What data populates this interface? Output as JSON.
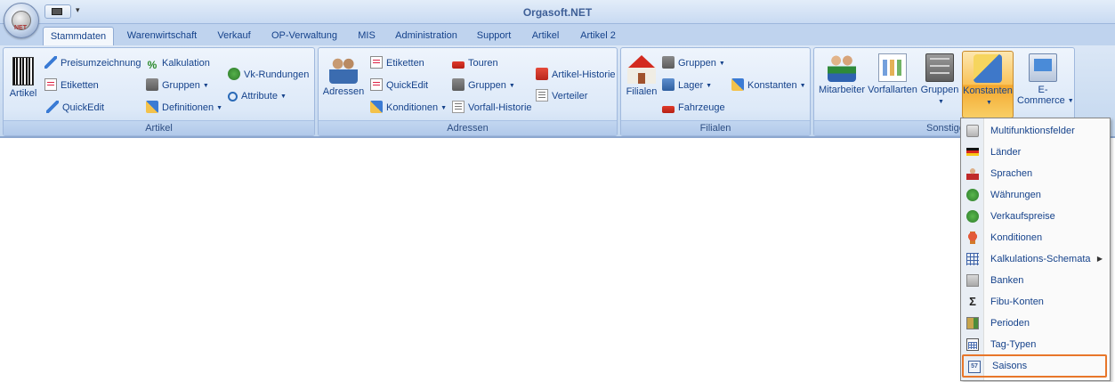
{
  "app": {
    "title": "Orgasoft.NET",
    "orb_text": "NET"
  },
  "tabs": [
    "Stammdaten",
    "Warenwirtschaft",
    "Verkauf",
    "OP-Verwaltung",
    "MIS",
    "Administration",
    "Support",
    "Artikel",
    "Artikel 2"
  ],
  "groups": {
    "artikel": {
      "label": "Artikel",
      "big_button": "Artikel",
      "items": [
        "Preisumzeichnung",
        "Etiketten",
        "QuickEdit",
        "Kalkulation",
        "Gruppen",
        "Definitionen",
        "Vk-Rundungen",
        "Attribute"
      ]
    },
    "adressen": {
      "label": "Adressen",
      "big_button": "Adressen",
      "items": [
        "Etiketten",
        "QuickEdit",
        "Konditionen",
        "Touren",
        "Gruppen",
        "Vorfall-Historie",
        "Artikel-Historie",
        "Verteiler"
      ]
    },
    "filialen": {
      "label": "Filialen",
      "big_button": "Filialen",
      "items": [
        "Gruppen",
        "Lager",
        "Fahrzeuge",
        "Konstanten"
      ]
    },
    "sonstige": {
      "label": "Sonstige",
      "buttons": [
        "Mitarbeiter",
        "Vorfallarten",
        "Gruppen",
        "Konstanten",
        "E-",
        "Commerce"
      ]
    }
  },
  "menu": {
    "items": [
      {
        "label": "Multifunktionsfelder",
        "icon": "fields-icon"
      },
      {
        "label": "Länder",
        "icon": "flag-icon"
      },
      {
        "label": "Sprachen",
        "icon": "person-icon"
      },
      {
        "label": "Währungen",
        "icon": "coin-icon"
      },
      {
        "label": "Verkaufspreise",
        "icon": "price-icon"
      },
      {
        "label": "Konditionen",
        "icon": "ribbon-icon"
      },
      {
        "label": "Kalkulations-Schemata",
        "icon": "grid-icon"
      },
      {
        "label": "Banken",
        "icon": "bank-icon"
      },
      {
        "label": "Fibu-Konten",
        "icon": "sigma-icon"
      },
      {
        "label": "Perioden",
        "icon": "period-icon"
      },
      {
        "label": "Tag-Typen",
        "icon": "calendar-icon"
      },
      {
        "label": "Saisons",
        "icon": "calendar-season-icon"
      }
    ],
    "selected": "Saisons",
    "cal_icon_text": "57"
  },
  "colors": {
    "accent": "#e8762a",
    "ribbon_text": "#15428b",
    "title": "#3e5f97"
  }
}
